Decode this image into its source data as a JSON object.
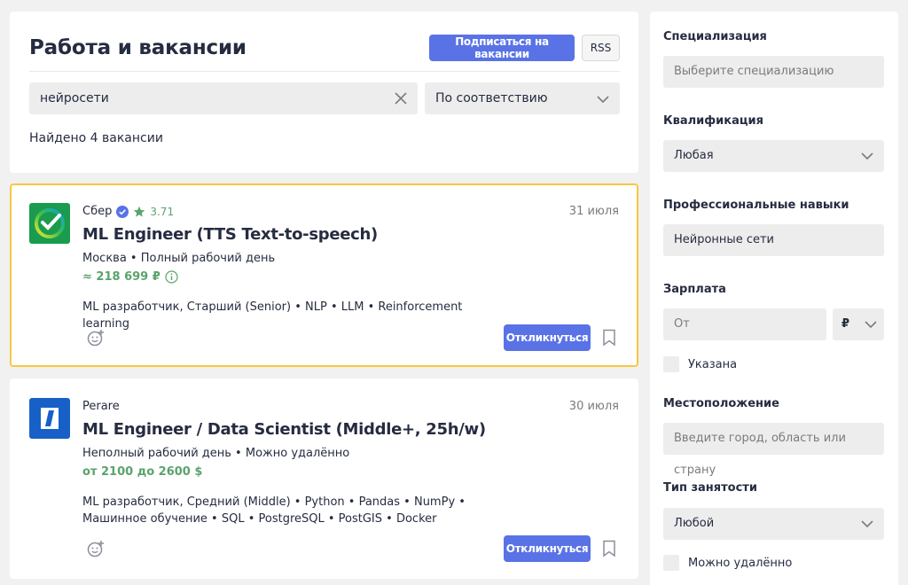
{
  "header": {
    "title": "Работа и вакансии",
    "subscribe_label": "Подписаться на вакансии",
    "rss_label": "RSS",
    "search_value": "нейросети",
    "sort_selected": "По соответствию",
    "found_text": "Найдено 4 вакансии"
  },
  "vacancies": [
    {
      "company": "Сбер",
      "verified": true,
      "rating": "3.71",
      "date": "31 июля",
      "title": "ML Engineer (TTS Text-to-speech)",
      "meta": "Москва • Полный рабочий день",
      "salary": "≈ 218 699 ₽",
      "skills": "ML разработчик, Старший (Senior) • NLP • LLM • Reinforcement learning",
      "apply_label": "Откликнуться",
      "logo_icon": "sber-logo-icon",
      "highlighted": true
    },
    {
      "company": "Perare",
      "verified": false,
      "rating": "",
      "date": "30 июля",
      "title": "ML Engineer / Data Scientist (Middle+, 25h/w)",
      "meta": "Неполный рабочий день • Можно удалённо",
      "salary": "от 2100 до 2600 $",
      "skills": "ML разработчик, Средний (Middle) • Python • Pandas • NumPy • Машинное обучение • SQL • PostgreSQL • PostGIS • Docker",
      "apply_label": "Откликнуться",
      "logo_icon": "perare-logo-icon",
      "highlighted": false
    }
  ],
  "sidebar": {
    "specialization_label": "Специализация",
    "specialization_placeholder": "Выберите специализацию",
    "qualification_label": "Квалификация",
    "qualification_value": "Любая",
    "skills_label": "Профессиональные навыки",
    "skills_value": "Нейронные сети",
    "salary_label": "Зарплата",
    "salary_placeholder": "От",
    "currency": "₽",
    "salary_specified_label": "Указана",
    "location_label": "Местоположение",
    "location_placeholder": "Введите город, область или страну",
    "employment_label": "Тип занятости",
    "employment_value": "Любой",
    "remote_label": "Можно удалённо"
  },
  "colors": {
    "accent": "#5973e6",
    "salary_green": "#5aa36b",
    "highlight_border": "#f7c841",
    "background": "#f1f1f1"
  }
}
